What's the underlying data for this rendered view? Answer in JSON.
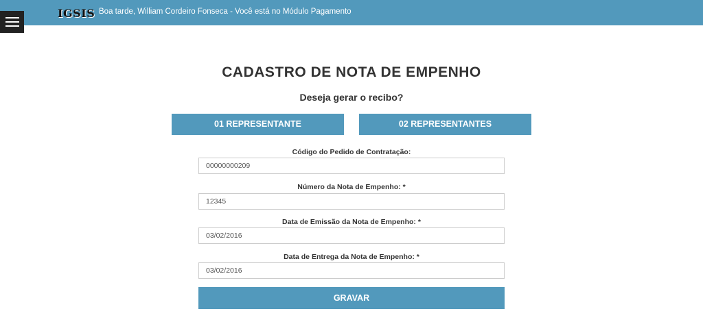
{
  "header": {
    "logo": "IGSIS",
    "greeting": "Boa tarde, William Cordeiro Fonseca - Você está no Módulo Pagamento"
  },
  "menu": {
    "icon": "hamburger-icon"
  },
  "page": {
    "title": "CADASTRO DE NOTA DE EMPENHO",
    "subtitle": "Deseja gerar o recibo?"
  },
  "choices": {
    "one_label": "01 REPRESENTANTE",
    "two_label": "02 REPRESENTANTES"
  },
  "form": {
    "fields": [
      {
        "label": "Código do Pedido de Contratação:",
        "value": "00000000209"
      },
      {
        "label": "Número da Nota de Empenho: *",
        "value": "12345"
      },
      {
        "label": "Data de Emissão da Nota de Empenho: *",
        "value": "03/02/2016"
      },
      {
        "label": "Data de Entrega da Nota de Empenho: *",
        "value": "03/02/2016"
      }
    ],
    "save_label": "GRAVAR"
  },
  "colors": {
    "accent": "#5299bc",
    "menu_bg": "#222222",
    "text": "#333333"
  }
}
